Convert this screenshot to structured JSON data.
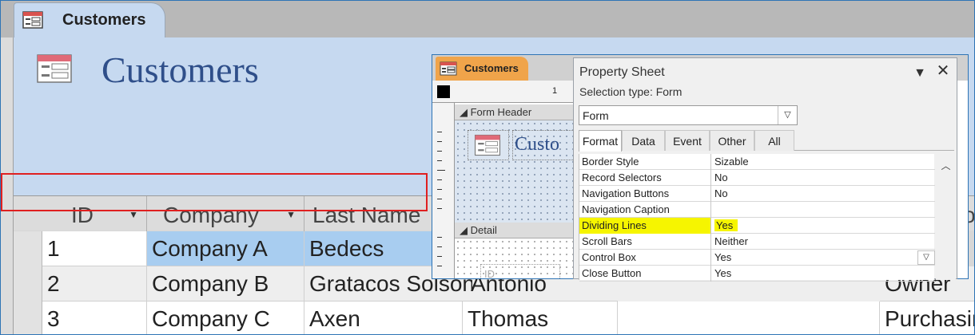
{
  "document_tab": {
    "label": "Customers"
  },
  "form_header": {
    "title": "Customers"
  },
  "datasheet": {
    "columns": [
      {
        "label": "ID"
      },
      {
        "label": "Company"
      },
      {
        "label": "Last Name"
      }
    ],
    "rows": [
      {
        "id": "1",
        "company": "Company A",
        "last_name": "Bedecs",
        "first_name": "",
        "job_title": ""
      },
      {
        "id": "2",
        "company": "Company B",
        "last_name": "Gratacos Solsona",
        "first_name": "Antonio",
        "job_title": "Owner"
      },
      {
        "id": "3",
        "company": "Company C",
        "last_name": "Axen",
        "first_name": "Thomas",
        "job_title": "Purchasing"
      }
    ],
    "partial_header_glyph": "o",
    "selected_row_color": "#a8cdf0"
  },
  "design_view": {
    "tab_label": "Customers",
    "ruler_number": "1",
    "form_header_label": "Form Header",
    "detail_label": "Detail",
    "header_title_preview": "Custo",
    "id_control_label": "ID"
  },
  "property_sheet": {
    "title": "Property Sheet",
    "selection_type": "Selection type:  Form",
    "selected_object": "Form",
    "tabs": [
      {
        "label": "Format",
        "active": true
      },
      {
        "label": "Data",
        "active": false
      },
      {
        "label": "Event",
        "active": false
      },
      {
        "label": "Other",
        "active": false
      },
      {
        "label": "All",
        "active": false
      }
    ],
    "properties": [
      {
        "name": "Border Style",
        "value": "Sizable"
      },
      {
        "name": "Record Selectors",
        "value": "No"
      },
      {
        "name": "Navigation Buttons",
        "value": "No"
      },
      {
        "name": "Navigation Caption",
        "value": ""
      },
      {
        "name": "Dividing Lines",
        "value": "Yes",
        "highlighted": true
      },
      {
        "name": "Scroll Bars",
        "value": "Neither"
      },
      {
        "name": "Control Box",
        "value": "Yes"
      },
      {
        "name": "Close Button",
        "value": "Yes"
      }
    ]
  },
  "colors": {
    "header_band": "#c6d9f0",
    "title_text": "#2f4f8a",
    "design_tab": "#f0a44a",
    "highlight": "#f6f500",
    "callout_border": "#e02020"
  },
  "icons": {
    "form_icon": "form-icon",
    "dropdown": "triangle-down-icon",
    "close": "close-icon",
    "combo_arrow": "chevron-down-icon",
    "scroll_up": "chevron-up-icon"
  }
}
